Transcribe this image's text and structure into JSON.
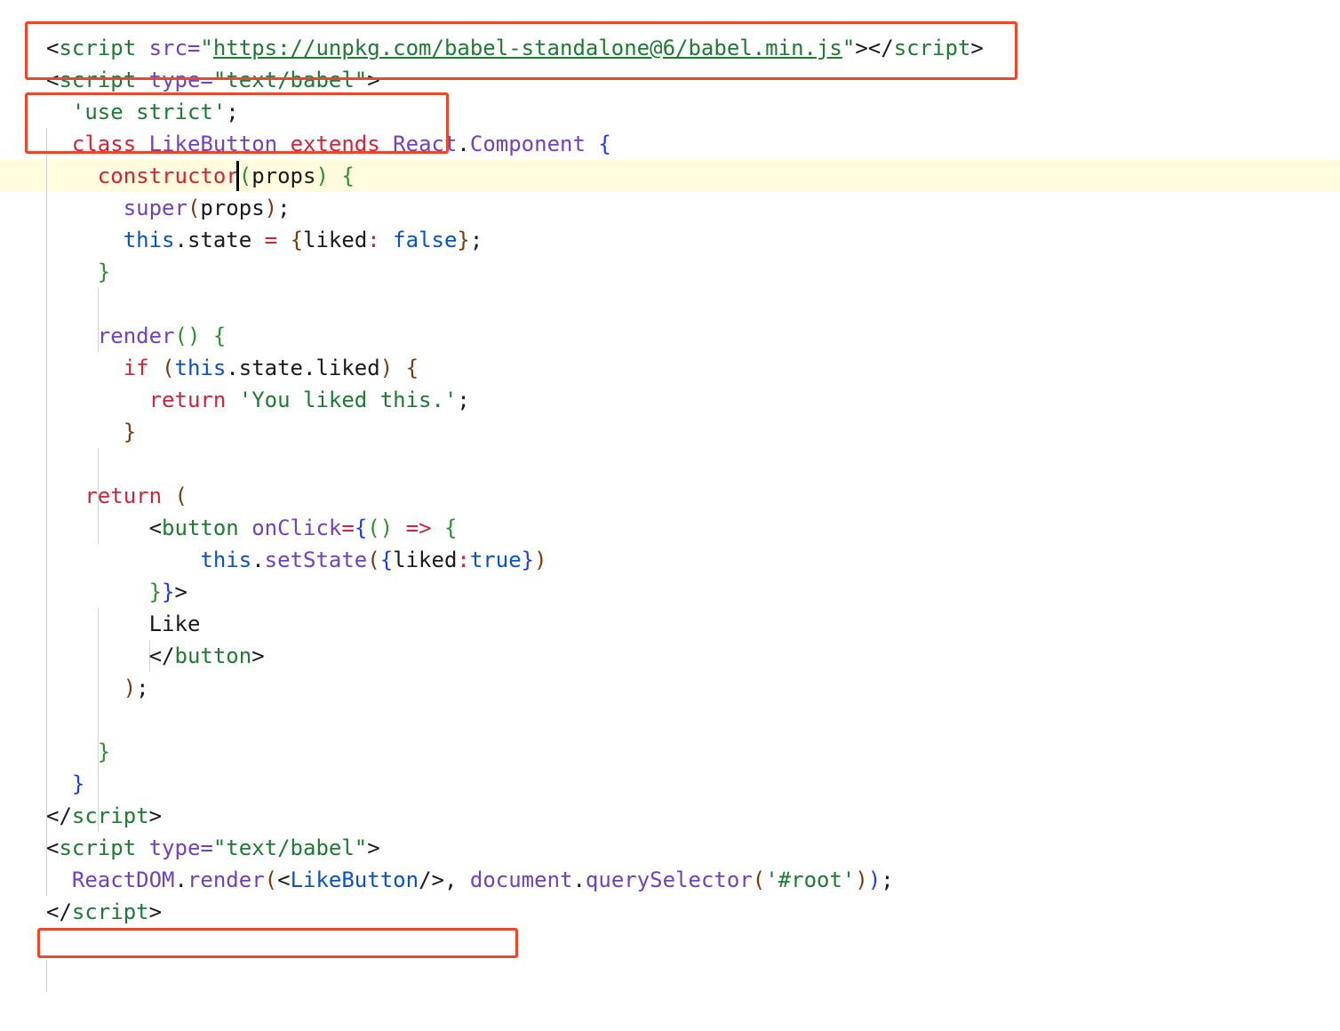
{
  "editor": {
    "language": "html",
    "highlight_color": "#e8482c",
    "current_line_color": "#fffbdd",
    "lines": [
      [
        {
          "t": "<",
          "c": "punc"
        },
        {
          "t": "script",
          "c": "tag"
        },
        {
          "t": " src=",
          "c": "attr"
        },
        {
          "t": "\"",
          "c": "str"
        },
        {
          "t": "https://unpkg.com/babel-standalone@6/babel.min.js",
          "c": "url"
        },
        {
          "t": "\"",
          "c": "str"
        },
        {
          "t": "></",
          "c": "punc"
        },
        {
          "t": "script",
          "c": "tag"
        },
        {
          "t": ">",
          "c": "punc"
        }
      ],
      [
        {
          "t": "<",
          "c": "punc"
        },
        {
          "t": "script",
          "c": "tag"
        },
        {
          "t": " type=",
          "c": "attr"
        },
        {
          "t": "\"text/babel\"",
          "c": "str"
        },
        {
          "t": ">",
          "c": "punc"
        }
      ],
      [
        {
          "t": "  'use strict'",
          "c": "str"
        },
        {
          "t": ";",
          "c": "punc"
        }
      ],
      [
        {
          "t": "  ",
          "c": "plain"
        },
        {
          "t": "class",
          "c": "kw"
        },
        {
          "t": " ",
          "c": "plain"
        },
        {
          "t": "LikeButton",
          "c": "cls"
        },
        {
          "t": " ",
          "c": "plain"
        },
        {
          "t": "extends",
          "c": "kw"
        },
        {
          "t": " ",
          "c": "plain"
        },
        {
          "t": "React",
          "c": "cls"
        },
        {
          "t": ".",
          "c": "punc"
        },
        {
          "t": "Component",
          "c": "cls"
        },
        {
          "t": " ",
          "c": "plain"
        },
        {
          "t": "{",
          "c": "brace-blue"
        }
      ],
      [
        {
          "t": "    ",
          "c": "plain"
        },
        {
          "t": "constructor",
          "c": "kw"
        },
        {
          "t": "(",
          "c": "brace-green"
        },
        {
          "t": "props",
          "c": "plain"
        },
        {
          "t": ")",
          "c": "brace-green"
        },
        {
          "t": " ",
          "c": "plain"
        },
        {
          "t": "{",
          "c": "brace-green"
        }
      ],
      [
        {
          "t": "      ",
          "c": "plain"
        },
        {
          "t": "super",
          "c": "fn"
        },
        {
          "t": "(",
          "c": "paren-brown"
        },
        {
          "t": "props",
          "c": "plain"
        },
        {
          "t": ")",
          "c": "paren-brown"
        },
        {
          "t": ";",
          "c": "punc"
        }
      ],
      [
        {
          "t": "      ",
          "c": "plain"
        },
        {
          "t": "this",
          "c": "this"
        },
        {
          "t": ".state ",
          "c": "plain"
        },
        {
          "t": "=",
          "c": "op"
        },
        {
          "t": " ",
          "c": "plain"
        },
        {
          "t": "{",
          "c": "paren-brown"
        },
        {
          "t": "liked",
          "c": "plain"
        },
        {
          "t": ":",
          "c": "op"
        },
        {
          "t": " ",
          "c": "plain"
        },
        {
          "t": "false",
          "c": "bool"
        },
        {
          "t": "}",
          "c": "paren-brown"
        },
        {
          "t": ";",
          "c": "punc"
        }
      ],
      [
        {
          "t": "    ",
          "c": "plain"
        },
        {
          "t": "}",
          "c": "brace-green"
        }
      ],
      [
        {
          "t": "",
          "c": "plain"
        }
      ],
      [
        {
          "t": "    ",
          "c": "plain"
        },
        {
          "t": "render",
          "c": "fn"
        },
        {
          "t": "()",
          "c": "brace-green"
        },
        {
          "t": " ",
          "c": "plain"
        },
        {
          "t": "{",
          "c": "brace-green"
        }
      ],
      [
        {
          "t": "      ",
          "c": "plain"
        },
        {
          "t": "if",
          "c": "kw"
        },
        {
          "t": " ",
          "c": "plain"
        },
        {
          "t": "(",
          "c": "paren-brown"
        },
        {
          "t": "this",
          "c": "this"
        },
        {
          "t": ".state.liked",
          "c": "plain"
        },
        {
          "t": ")",
          "c": "paren-brown"
        },
        {
          "t": " ",
          "c": "plain"
        },
        {
          "t": "{",
          "c": "paren-brown"
        }
      ],
      [
        {
          "t": "        ",
          "c": "plain"
        },
        {
          "t": "return",
          "c": "kw"
        },
        {
          "t": " ",
          "c": "plain"
        },
        {
          "t": "'You liked this.'",
          "c": "str"
        },
        {
          "t": ";",
          "c": "punc"
        }
      ],
      [
        {
          "t": "      ",
          "c": "plain"
        },
        {
          "t": "}",
          "c": "paren-brown"
        }
      ],
      [
        {
          "t": "",
          "c": "plain"
        }
      ],
      [
        {
          "t": "   ",
          "c": "plain"
        },
        {
          "t": "return",
          "c": "kw"
        },
        {
          "t": " ",
          "c": "plain"
        },
        {
          "t": "(",
          "c": "paren-brown"
        }
      ],
      [
        {
          "t": "        <",
          "c": "punc"
        },
        {
          "t": "button",
          "c": "tag"
        },
        {
          "t": " ",
          "c": "plain"
        },
        {
          "t": "onClick",
          "c": "attr"
        },
        {
          "t": "=",
          "c": "op"
        },
        {
          "t": "{",
          "c": "brace-blue"
        },
        {
          "t": "()",
          "c": "brace-green"
        },
        {
          "t": " ",
          "c": "plain"
        },
        {
          "t": "=>",
          "c": "op"
        },
        {
          "t": " ",
          "c": "plain"
        },
        {
          "t": "{",
          "c": "brace-green"
        }
      ],
      [
        {
          "t": "            ",
          "c": "plain"
        },
        {
          "t": "this",
          "c": "this"
        },
        {
          "t": ".",
          "c": "punc"
        },
        {
          "t": "setState",
          "c": "fn"
        },
        {
          "t": "(",
          "c": "paren-brown"
        },
        {
          "t": "{",
          "c": "brace-blue"
        },
        {
          "t": "liked",
          "c": "plain"
        },
        {
          "t": ":",
          "c": "op"
        },
        {
          "t": "true",
          "c": "bool"
        },
        {
          "t": "}",
          "c": "brace-blue"
        },
        {
          "t": ")",
          "c": "paren-brown"
        }
      ],
      [
        {
          "t": "        ",
          "c": "plain"
        },
        {
          "t": "}",
          "c": "brace-green"
        },
        {
          "t": "}",
          "c": "brace-blue"
        },
        {
          "t": ">",
          "c": "punc"
        }
      ],
      [
        {
          "t": "        Like",
          "c": "plain"
        }
      ],
      [
        {
          "t": "        </",
          "c": "punc"
        },
        {
          "t": "button",
          "c": "tag"
        },
        {
          "t": ">",
          "c": "punc"
        }
      ],
      [
        {
          "t": "      ",
          "c": "plain"
        },
        {
          "t": ")",
          "c": "paren-brown"
        },
        {
          "t": ";",
          "c": "punc"
        }
      ],
      [
        {
          "t": "",
          "c": "plain"
        }
      ],
      [
        {
          "t": "    ",
          "c": "plain"
        },
        {
          "t": "}",
          "c": "brace-green"
        }
      ],
      [
        {
          "t": "  ",
          "c": "plain"
        },
        {
          "t": "}",
          "c": "brace-blue"
        }
      ],
      [
        {
          "t": "</",
          "c": "punc"
        },
        {
          "t": "script",
          "c": "tag"
        },
        {
          "t": ">",
          "c": "punc"
        }
      ],
      [
        {
          "t": "<",
          "c": "punc"
        },
        {
          "t": "script",
          "c": "tag"
        },
        {
          "t": " type=",
          "c": "attr"
        },
        {
          "t": "\"text/babel\"",
          "c": "str"
        },
        {
          "t": ">",
          "c": "punc"
        }
      ],
      [
        {
          "t": "  ",
          "c": "plain"
        },
        {
          "t": "ReactDOM",
          "c": "cls"
        },
        {
          "t": ".",
          "c": "punc"
        },
        {
          "t": "render",
          "c": "fn"
        },
        {
          "t": "(",
          "c": "paren-brown"
        },
        {
          "t": "<",
          "c": "punc"
        },
        {
          "t": "LikeButton",
          "c": "this"
        },
        {
          "t": "/>",
          "c": "punc"
        },
        {
          "t": ", ",
          "c": "comma"
        },
        {
          "t": "document",
          "c": "fn"
        },
        {
          "t": ".",
          "c": "punc"
        },
        {
          "t": "querySelector",
          "c": "fn"
        },
        {
          "t": "(",
          "c": "paren-brown"
        },
        {
          "t": "'#root'",
          "c": "str"
        },
        {
          "t": ")",
          "c": "paren-brown"
        },
        {
          "t": ")",
          "c": "brace-blue"
        },
        {
          "t": ";",
          "c": "punc"
        }
      ],
      [
        {
          "t": "</",
          "c": "punc"
        },
        {
          "t": "script",
          "c": "tag"
        },
        {
          "t": ">",
          "c": "punc"
        }
      ]
    ]
  }
}
